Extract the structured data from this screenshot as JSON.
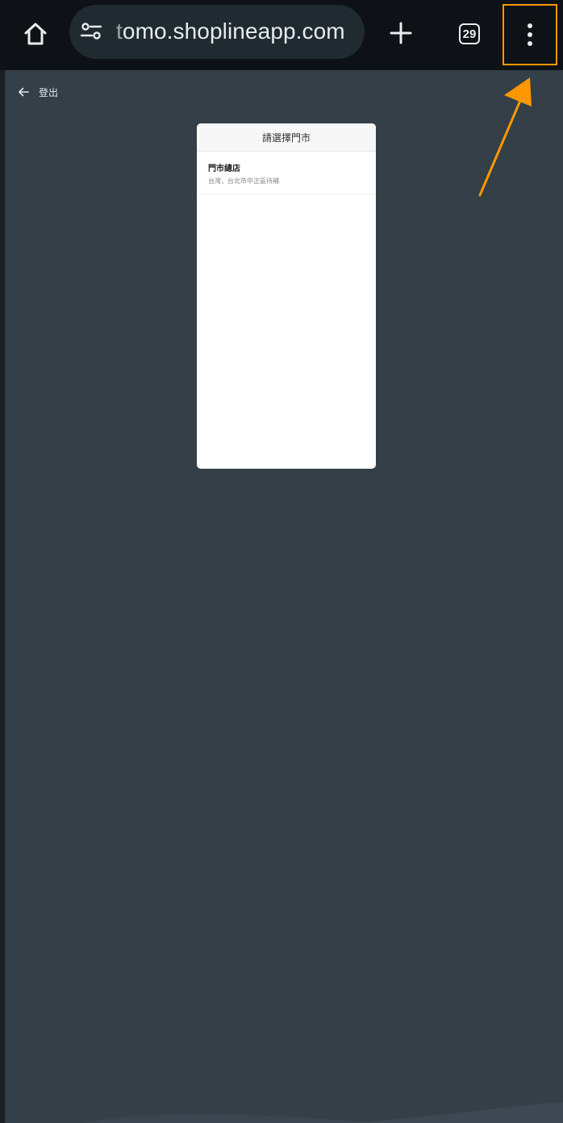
{
  "browser": {
    "url_prefix": "t",
    "url_rest": "omo.shoplineapp.com",
    "tab_count": "29",
    "icons": {
      "home": "home-icon",
      "site_settings": "tune-icon",
      "new_tab": "plus-icon",
      "tabs": "tab-switcher-icon",
      "menu": "more-vert-icon"
    }
  },
  "page": {
    "back_label": "登出",
    "store_picker": {
      "title": "請選擇門市",
      "stores": [
        {
          "name": "門市總店",
          "address": "台灣，台北市中正區待補"
        }
      ]
    }
  },
  "annotation": {
    "color": "#ff9800"
  },
  "colors": {
    "background": "#343f48",
    "browser_bar": "#0e1216",
    "url_pill": "#1f2a31"
  }
}
